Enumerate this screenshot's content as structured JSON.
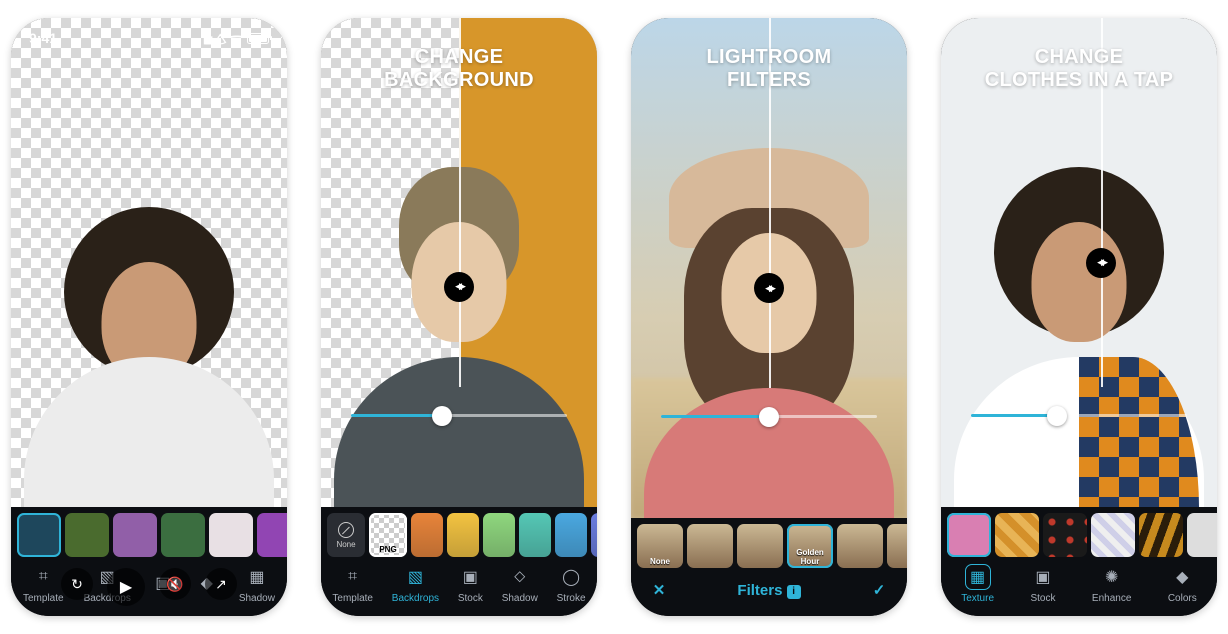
{
  "screens": [
    {
      "status_time": "9:41",
      "thumb_labels": [
        "",
        "",
        "",
        "",
        "",
        ""
      ],
      "thumb_colors": [
        "#1e475c",
        "#4a6b2e",
        "#915fa8",
        "#3b6e40",
        "#e8e0e4",
        "#9145b3"
      ],
      "toolbar": [
        {
          "icon": "⌗",
          "label": "Template"
        },
        {
          "icon": "▧",
          "label": "Backdrops"
        },
        {
          "icon": "▣",
          "label": ""
        },
        {
          "icon": "◆",
          "label": ""
        },
        {
          "icon": "▦",
          "label": "Shadow"
        }
      ]
    },
    {
      "headline": "CHANGE\nBACKGROUND",
      "slider_pct": 42,
      "none_label": "None",
      "png_label": "PNG",
      "swatches": [
        "#e8843a",
        "#f3c341",
        "#8fd77e",
        "#55c7b5",
        "#4aa8e0",
        "#6a7de0"
      ],
      "toolbar": [
        {
          "icon": "⌗",
          "label": "Template",
          "active": false
        },
        {
          "icon": "▧",
          "label": "Backdrops",
          "active": true
        },
        {
          "icon": "▣",
          "label": "Stock",
          "active": false
        },
        {
          "icon": "⬦",
          "label": "Shadow",
          "active": false
        },
        {
          "icon": "◯",
          "label": "Stroke",
          "active": false
        }
      ]
    },
    {
      "headline": "LIGHTROOM\nFILTERS",
      "slider_pct": 50,
      "filter_thumbs": [
        {
          "label": "None",
          "sel": false
        },
        {
          "label": "",
          "sel": false
        },
        {
          "label": "",
          "sel": false
        },
        {
          "label": "Golden Hour",
          "sel": true
        },
        {
          "label": "",
          "sel": false
        },
        {
          "label": "",
          "sel": false
        }
      ],
      "confirm_label": "Filters"
    },
    {
      "headline": "CHANGE\nCLOTHES IN A TAP",
      "slider_pct": 40,
      "texture_thumbs": [
        "#d97fb2",
        "repeating-linear-gradient(45deg,#d4902a 0 8px,#e8b456 8px 16px)",
        "radial-gradient(circle,#c0392b 3px,#1a1a1a 4px) 0 0/18px 18px",
        "repeating-linear-gradient(45deg,#efefef 0 6px,#cfcfe8 6px 12px)",
        "repeating-linear-gradient(110deg,#c78a1e 0 8px,#2b1d0a 8px 16px)",
        "#dddddd"
      ],
      "toolbar": [
        {
          "icon": "▦",
          "label": "Texture",
          "active": true
        },
        {
          "icon": "▣",
          "label": "Stock",
          "active": false
        },
        {
          "icon": "✺",
          "label": "Enhance",
          "active": false
        },
        {
          "icon": "◆",
          "label": "Colors",
          "active": false
        }
      ]
    }
  ]
}
